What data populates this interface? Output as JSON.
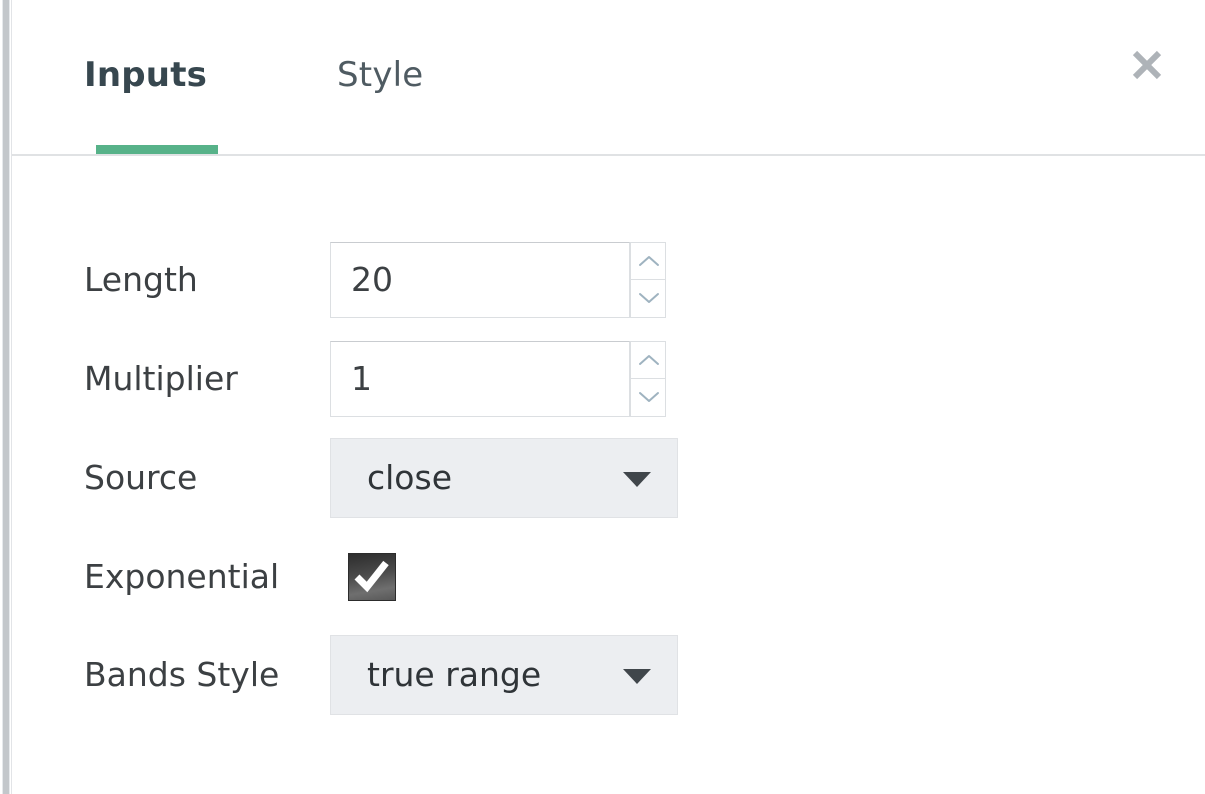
{
  "dialog": {
    "tabs": [
      {
        "id": "inputs",
        "label": "Inputs",
        "active": true
      },
      {
        "id": "style",
        "label": "Style",
        "active": false
      }
    ],
    "close_label": "close-icon",
    "accent_color": "#57b289",
    "tab_active_color": "#37474f",
    "tab_inactive_color": "#4f5b62"
  },
  "inputs": {
    "length": {
      "label": "Length",
      "value": "20",
      "placeholder": "",
      "increment_label": "increase",
      "decrement_label": "decrease"
    },
    "multiplier": {
      "label": "Multiplier",
      "value": "1",
      "placeholder": "",
      "increment_label": "increase",
      "decrement_label": "decrease"
    },
    "source": {
      "label": "Source",
      "value": "close"
    },
    "exponential": {
      "label": "Exponential",
      "checked": true,
      "check_glyph": "checkmark"
    },
    "bands_style": {
      "label": "Bands Style",
      "value": "true range"
    }
  }
}
